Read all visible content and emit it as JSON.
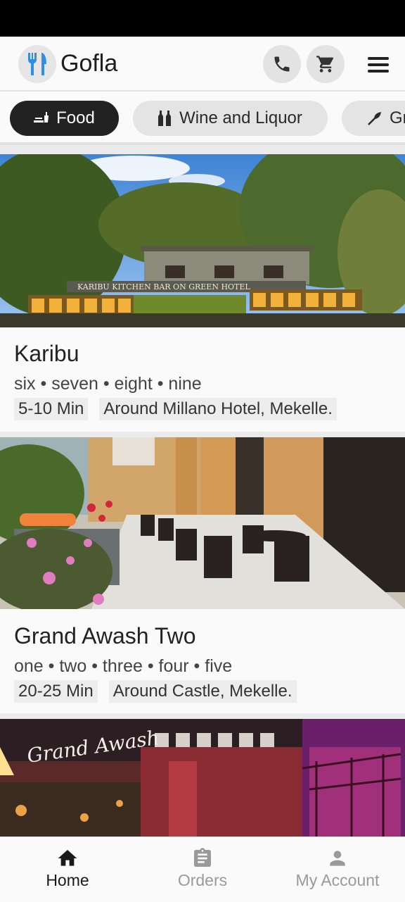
{
  "app": {
    "title": "Gofla"
  },
  "categories": [
    {
      "label": "Food",
      "icon": "food-icon",
      "active": true
    },
    {
      "label": "Wine and Liquor",
      "icon": "wine-bottles-icon",
      "active": false
    },
    {
      "label": "Gr",
      "icon": "herb-icon",
      "active": false
    }
  ],
  "restaurants": [
    {
      "name": "Karibu",
      "tags": "six • seven • eight • nine",
      "delivery_time": "5-10 Min",
      "location": "Around Millano Hotel, Mekelle.",
      "sign_text": "KARIBU KITCHEN  BAR ON GREEN HOTEL"
    },
    {
      "name": "Grand Awash Two",
      "tags": "one • two • three • four • five",
      "delivery_time": "20-25 Min",
      "location": "Around Castle, Mekelle."
    },
    {
      "name": "",
      "sign_text": "Grand Awash"
    }
  ],
  "bottom_nav": [
    {
      "label": "Home",
      "icon": "home-icon",
      "active": true
    },
    {
      "label": "Orders",
      "icon": "clipboard-icon",
      "active": false
    },
    {
      "label": "My Account",
      "icon": "person-icon",
      "active": false
    }
  ],
  "colors": {
    "accent_blue": "#2f8ee6",
    "chip_active": "#222222",
    "chip_inactive": "#e4e4e4"
  }
}
